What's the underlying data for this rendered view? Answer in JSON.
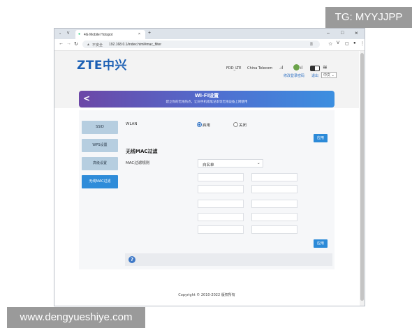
{
  "watermarks": {
    "tg": "TG: MYYJJPP",
    "site": "www.dengyueshiye.com"
  },
  "browser": {
    "tab_title": "4G Mobile Hotspot",
    "new_tab": "+",
    "url_security": "不安全",
    "url": "192.168.0.1/index.html#mac_filter",
    "window_controls": {
      "minimize": "–",
      "maximize": "□",
      "close": "×"
    }
  },
  "header": {
    "logo": "ZTE中兴",
    "network": "FDD_LTE",
    "carrier": "China Telecom",
    "signal_icon": "signal-icon",
    "links": {
      "password": "修改登录密码",
      "logout": "退出"
    },
    "language": "中文"
  },
  "banner": {
    "title": "Wi-Fi设置",
    "subtitle": "建立你的无线热点，让同手机或笔记本等无线设备上网使用",
    "back": "<"
  },
  "sidebar": {
    "items": [
      {
        "label": "SSID",
        "active": false
      },
      {
        "label": "WPS设置",
        "active": false
      },
      {
        "label": "高级设置",
        "active": false
      },
      {
        "label": "无线MAC过滤",
        "active": true
      }
    ]
  },
  "wlan": {
    "label": "WLAN",
    "options": [
      {
        "label": "启用",
        "selected": true
      },
      {
        "label": "关闭",
        "selected": false
      }
    ],
    "apply": "应用"
  },
  "mac_filter": {
    "section_title": "无线MAC过滤",
    "rule_label": "MAC过滤规则",
    "rule_value": "白名单",
    "apply": "应用"
  },
  "help": {
    "icon": "?"
  },
  "footer": {
    "copyright": "Copyright © 2010-2022 版权所有"
  }
}
